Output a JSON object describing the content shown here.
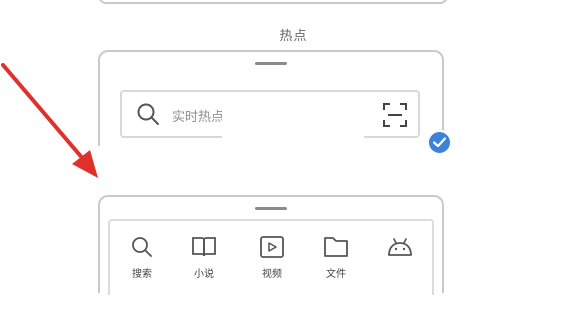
{
  "section_title": "热点",
  "search": {
    "placeholder": "实时热点"
  },
  "shortcuts": [
    {
      "label": "搜索",
      "icon": "search-icon"
    },
    {
      "label": "小说",
      "icon": "book-icon"
    },
    {
      "label": "视频",
      "icon": "video-icon"
    },
    {
      "label": "文件",
      "icon": "folder-icon"
    },
    {
      "label": "",
      "icon": "android-icon"
    }
  ],
  "colors": {
    "accent": "#3b82d9",
    "arrow": "#e0302a",
    "frame": "#c9c9c9"
  }
}
